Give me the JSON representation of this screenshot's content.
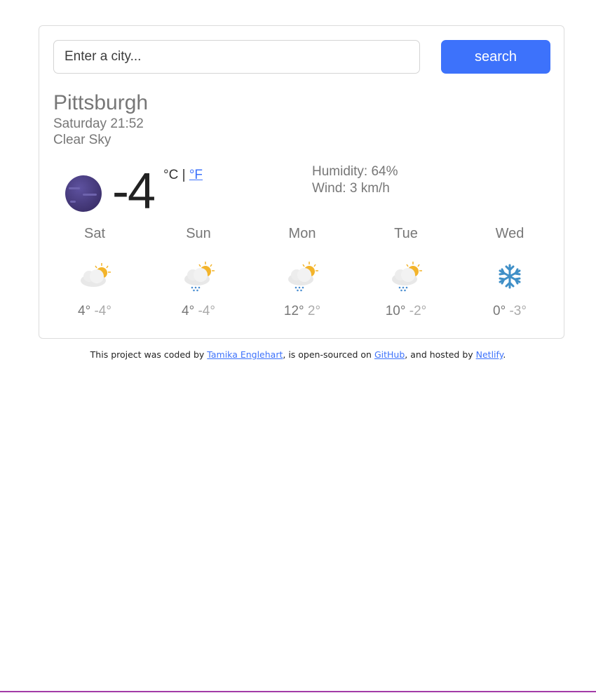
{
  "search": {
    "placeholder": "Enter a city...",
    "button_label": "search"
  },
  "current": {
    "city": "Pittsburgh",
    "datetime": "Saturday 21:52",
    "description": "Clear Sky",
    "icon": "moon-icon",
    "temperature": "-4",
    "unit_celsius": "°C",
    "unit_separator": "|",
    "unit_fahrenheit": "°F",
    "humidity": "Humidity: 64%",
    "wind": "Wind: 3 km/h"
  },
  "forecast": [
    {
      "day": "Sat",
      "icon": "partly-cloudy-icon",
      "max": "4°",
      "min": "-4°"
    },
    {
      "day": "Sun",
      "icon": "rain-partly-cloudy-icon",
      "max": "4°",
      "min": "-4°"
    },
    {
      "day": "Mon",
      "icon": "rain-partly-cloudy-icon",
      "max": "12°",
      "min": "2°"
    },
    {
      "day": "Tue",
      "icon": "rain-partly-cloudy-icon",
      "max": "10°",
      "min": "-2°"
    },
    {
      "day": "Wed",
      "icon": "snowflake-icon",
      "max": "0°",
      "min": "-3°"
    }
  ],
  "footer": {
    "prefix": "This project was coded by",
    "author": "Tamika Englehart",
    "middle": ", is open-sourced on",
    "github": "GitHub",
    "middle2": ", and hosted by",
    "netlify": "Netlify",
    "suffix": "."
  },
  "colors": {
    "accent": "#3d72fb",
    "moon": "#4a3e7a",
    "sun": "#f3b42b"
  }
}
